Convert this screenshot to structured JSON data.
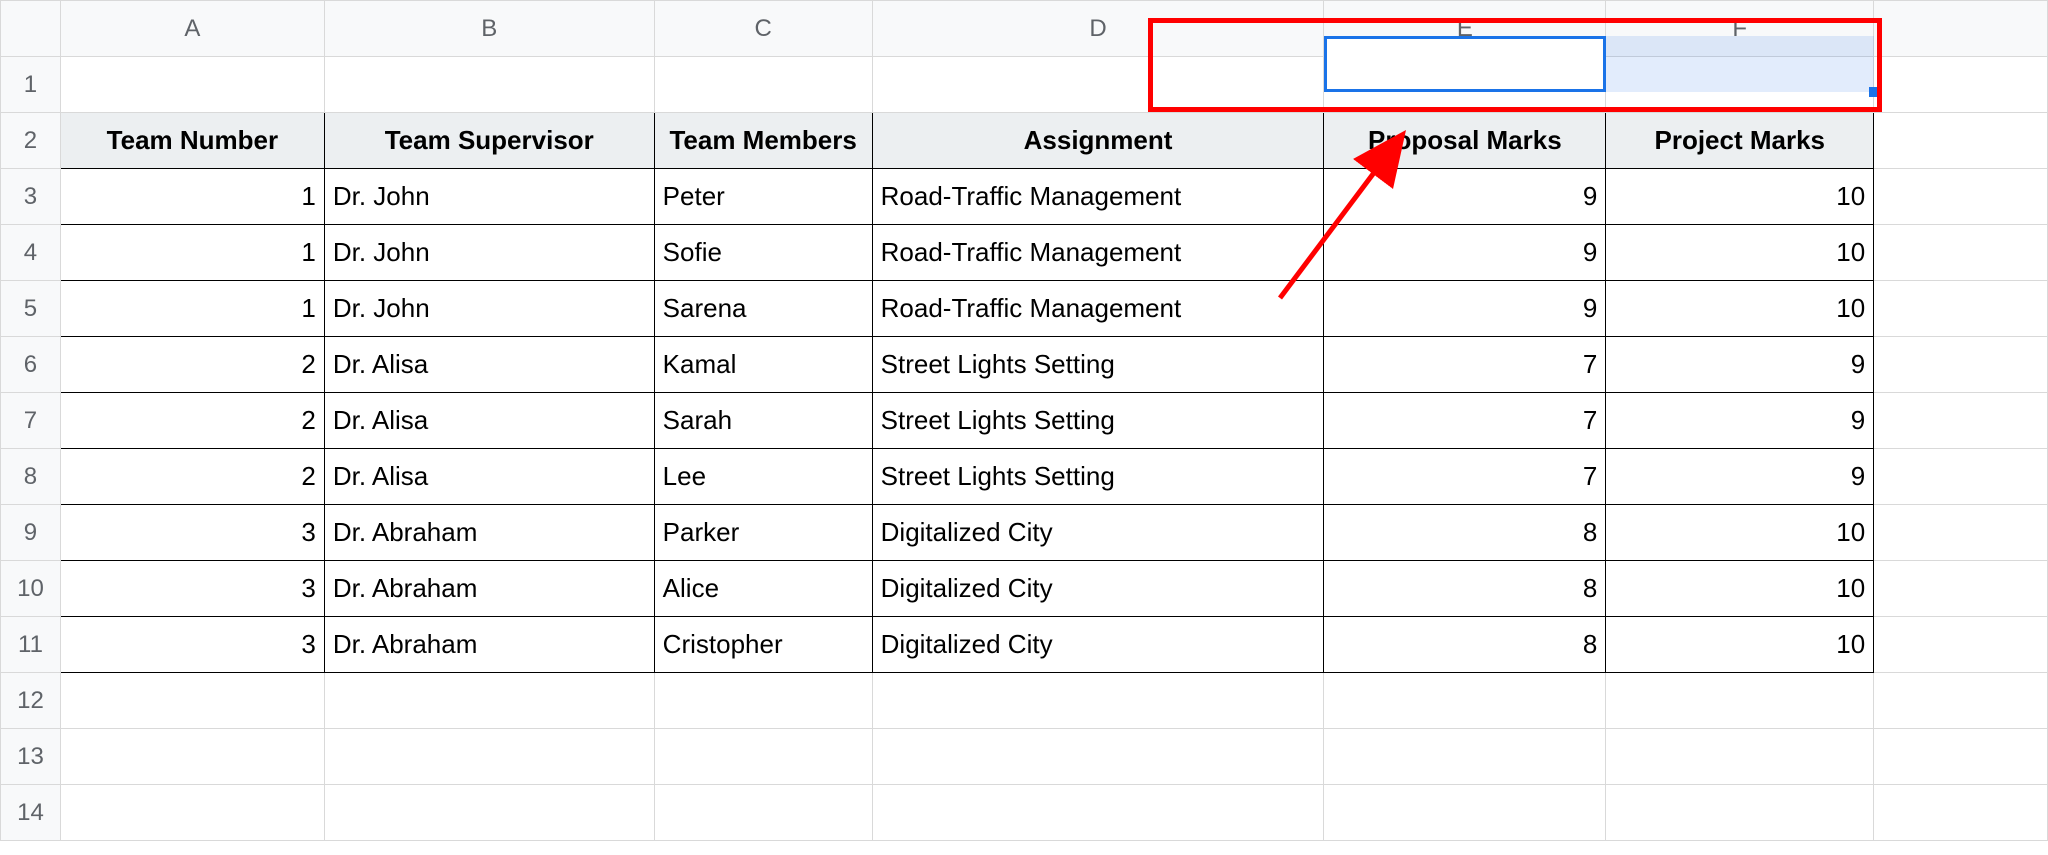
{
  "columns": [
    "A",
    "B",
    "C",
    "D",
    "E",
    "F",
    ""
  ],
  "rows": [
    "1",
    "2",
    "3",
    "4",
    "5",
    "6",
    "7",
    "8",
    "9",
    "10",
    "11",
    "12",
    "13",
    "14"
  ],
  "header_row": {
    "team_number": "Team Number",
    "team_supervisor": "Team Supervisor",
    "team_members": "Team Members",
    "assignment": "Assignment",
    "proposal_marks": "Proposal Marks",
    "project_marks": "Project Marks"
  },
  "body": [
    {
      "team_number": "1",
      "supervisor": "Dr. John",
      "member": "Peter",
      "assignment": "Road-Traffic Management",
      "proposal": "9",
      "project": "10"
    },
    {
      "team_number": "1",
      "supervisor": "Dr. John",
      "member": "Sofie",
      "assignment": "Road-Traffic Management",
      "proposal": "9",
      "project": "10"
    },
    {
      "team_number": "1",
      "supervisor": "Dr. John",
      "member": "Sarena",
      "assignment": "Road-Traffic Management",
      "proposal": "9",
      "project": "10"
    },
    {
      "team_number": "2",
      "supervisor": "Dr. Alisa",
      "member": "Kamal",
      "assignment": "Street Lights Setting",
      "proposal": "7",
      "project": "9"
    },
    {
      "team_number": "2",
      "supervisor": "Dr. Alisa",
      "member": "Sarah",
      "assignment": "Street Lights Setting",
      "proposal": "7",
      "project": "9"
    },
    {
      "team_number": "2",
      "supervisor": "Dr. Alisa",
      "member": "Lee",
      "assignment": "Street Lights Setting",
      "proposal": "7",
      "project": "9"
    },
    {
      "team_number": "3",
      "supervisor": "Dr. Abraham",
      "member": "Parker",
      "assignment": "Digitalized City",
      "proposal": "8",
      "project": "10"
    },
    {
      "team_number": "3",
      "supervisor": "Dr. Abraham",
      "member": "Alice",
      "assignment": "Digitalized City",
      "proposal": "8",
      "project": "10"
    },
    {
      "team_number": "3",
      "supervisor": "Dr. Abraham",
      "member": "Cristopher",
      "assignment": "Digitalized City",
      "proposal": "8",
      "project": "10"
    }
  ],
  "chart_data": {
    "type": "table",
    "columns": [
      "Team Number",
      "Team Supervisor",
      "Team Members",
      "Assignment",
      "Proposal Marks",
      "Project Marks"
    ],
    "rows": [
      [
        1,
        "Dr. John",
        "Peter",
        "Road-Traffic Management",
        9,
        10
      ],
      [
        1,
        "Dr. John",
        "Sofie",
        "Road-Traffic Management",
        9,
        10
      ],
      [
        1,
        "Dr. John",
        "Sarena",
        "Road-Traffic Management",
        9,
        10
      ],
      [
        2,
        "Dr. Alisa",
        "Kamal",
        "Street Lights Setting",
        7,
        9
      ],
      [
        2,
        "Dr. Alisa",
        "Sarah",
        "Street Lights Setting",
        7,
        9
      ],
      [
        2,
        "Dr. Alisa",
        "Lee",
        "Street Lights Setting",
        7,
        9
      ],
      [
        3,
        "Dr. Abraham",
        "Parker",
        "Digitalized City",
        8,
        10
      ],
      [
        3,
        "Dr. Abraham",
        "Alice",
        "Digitalized City",
        8,
        10
      ],
      [
        3,
        "Dr. Abraham",
        "Cristopher",
        "Digitalized City",
        8,
        10
      ]
    ]
  }
}
